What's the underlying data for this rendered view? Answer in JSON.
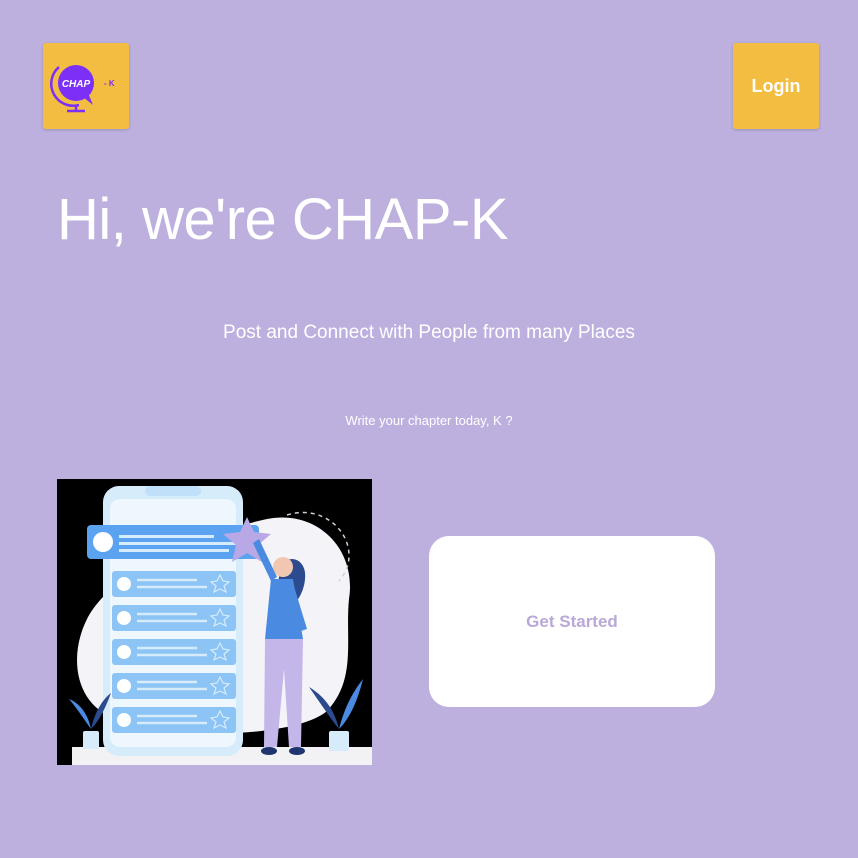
{
  "header": {
    "logo": {
      "text_left": "CHAP",
      "text_right": "- K",
      "icon": "globe-chat-icon"
    },
    "login_label": "Login"
  },
  "hero": {
    "title": "Hi, we're CHAP-K",
    "tagline": "Post and Connect with People from many Places",
    "subtagline": "Write your chapter today, K ?"
  },
  "illustration": {
    "icon": "phone-list-illustration"
  },
  "cta": {
    "label": "Get Started"
  },
  "colors": {
    "background": "#bdb0df",
    "accent": "#f2bd41",
    "button_text": "#b9a8d8",
    "logo_purple": "#7b2ff7"
  }
}
